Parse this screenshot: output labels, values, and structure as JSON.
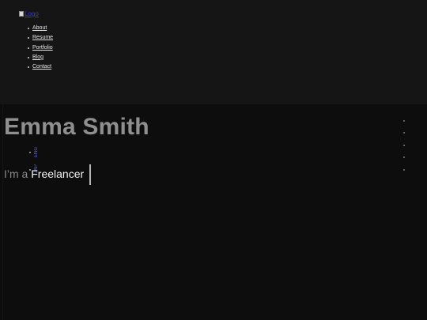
{
  "header": {
    "logo": {
      "alt": "Logo"
    },
    "nav": [
      "About",
      "Resume",
      "Portfolio",
      "Blog",
      "Contact"
    ]
  },
  "hero": {
    "name": "Emma Smith",
    "languages": [
      "ENG",
      "JAP"
    ],
    "tagline_prefix": "I’m a ",
    "tagline_role": "Freelancer"
  },
  "side_dots_count": 5
}
